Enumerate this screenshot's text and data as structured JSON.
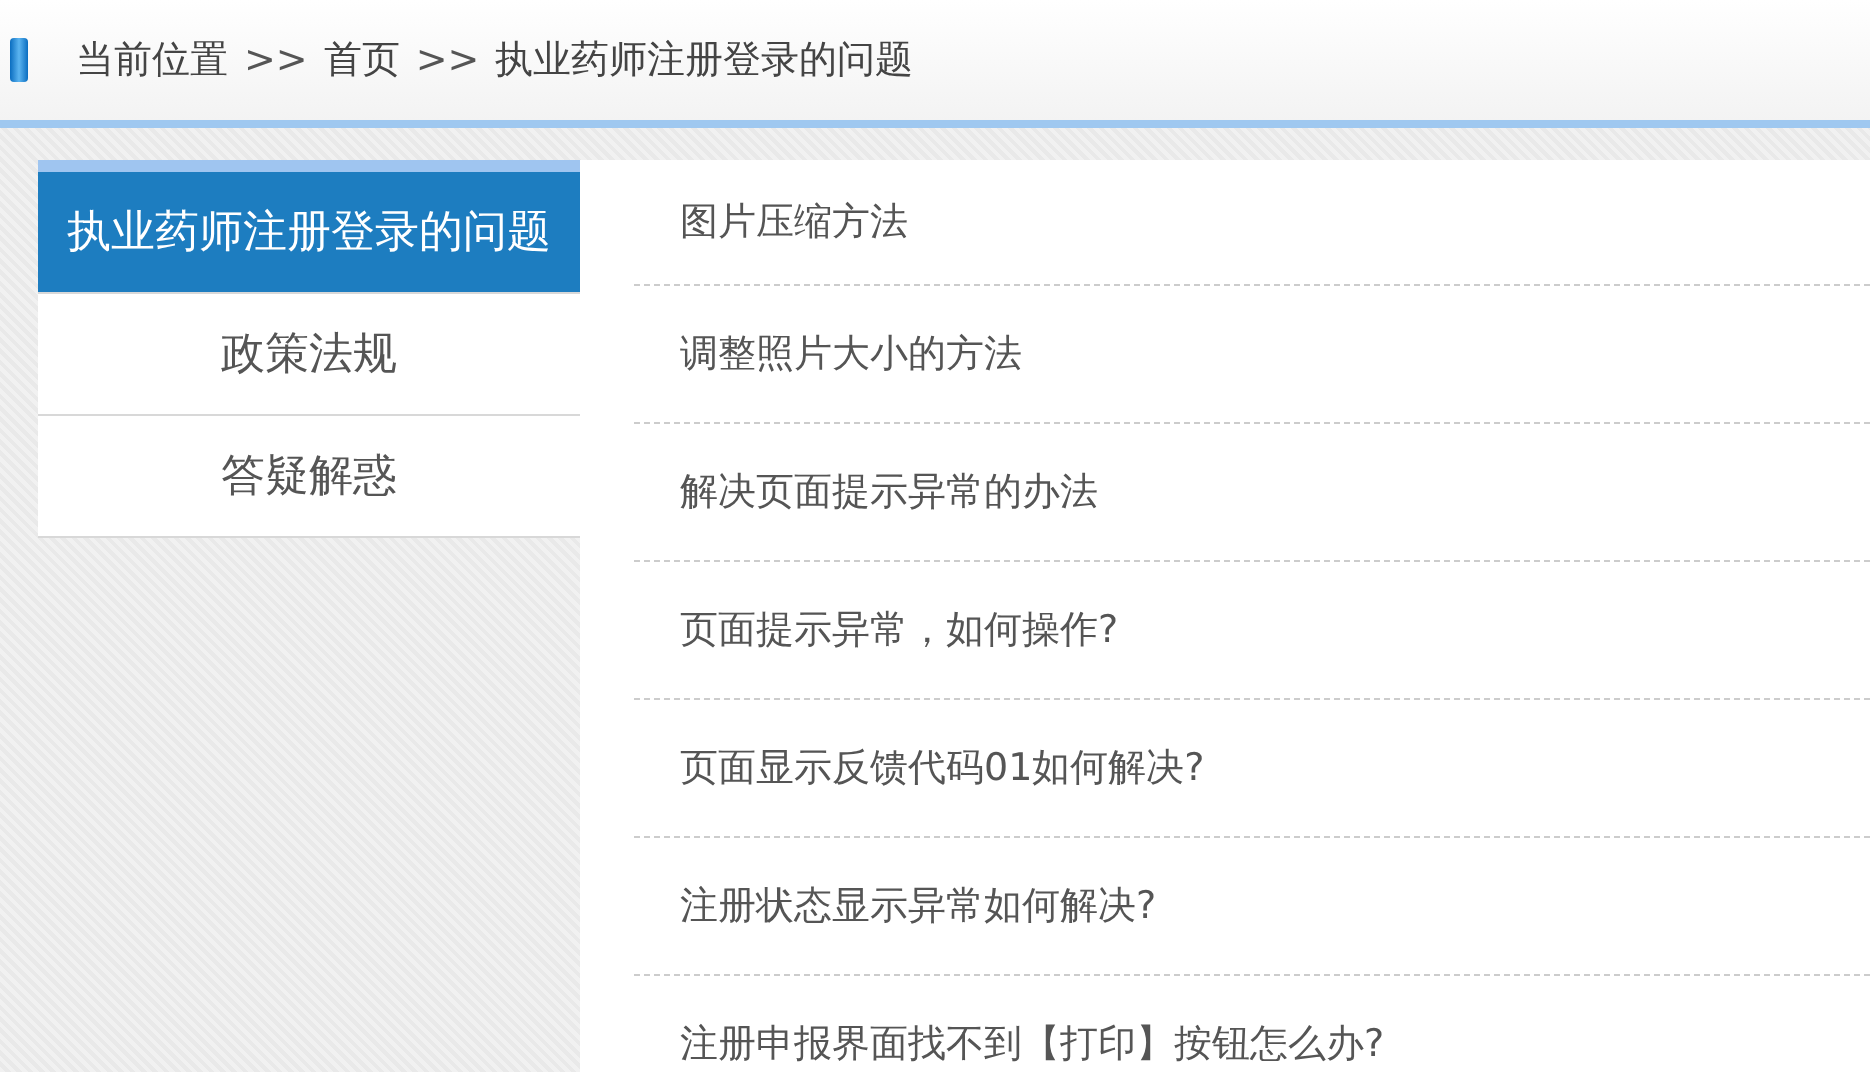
{
  "breadcrumb": {
    "items": [
      {
        "label": "当前位置"
      },
      {
        "label": "首页"
      },
      {
        "label": "执业药师注册登录的问题"
      }
    ],
    "separator": ">>"
  },
  "sidebar": {
    "items": [
      {
        "label": "执业药师注册登录的问题",
        "selected": true
      },
      {
        "label": "政策法规",
        "selected": false
      },
      {
        "label": "答疑解惑",
        "selected": false
      }
    ]
  },
  "articles": [
    {
      "title": "图片压缩方法"
    },
    {
      "title": "调整照片大小的方法"
    },
    {
      "title": "解决页面提示异常的办法"
    },
    {
      "title": "页面提示异常，如何操作?"
    },
    {
      "title": "页面显示反馈代码01如何解决?"
    },
    {
      "title": "注册状态显示异常如何解决?"
    },
    {
      "title": "注册申报界面找不到【打印】按钮怎么办?"
    }
  ]
}
